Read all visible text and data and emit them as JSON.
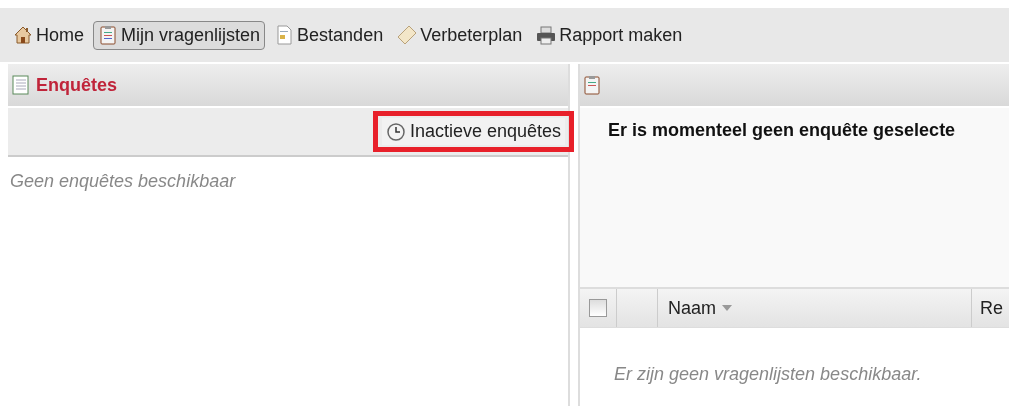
{
  "toolbar": [
    {
      "label": "Home",
      "selected": false
    },
    {
      "label": "Mijn vragenlijsten",
      "selected": true
    },
    {
      "label": "Bestanden",
      "selected": false
    },
    {
      "label": "Verbeterplan",
      "selected": false
    },
    {
      "label": "Rapport maken",
      "selected": false
    }
  ],
  "left_panel": {
    "title": "Enquêtes",
    "button": {
      "label": "Inactieve enquêtes",
      "highlighted": true
    },
    "empty_text": "Geen enquêtes beschikbaar"
  },
  "right_panel": {
    "message": "Er is momenteel geen enquête geselecte",
    "table": {
      "select_all": {
        "checked": false
      },
      "columns": [
        {
          "label": "Naam",
          "sorted": true
        },
        {
          "label": "Re"
        }
      ],
      "empty_text": "Er zijn geen vragenlijsten beschikbaar."
    }
  }
}
